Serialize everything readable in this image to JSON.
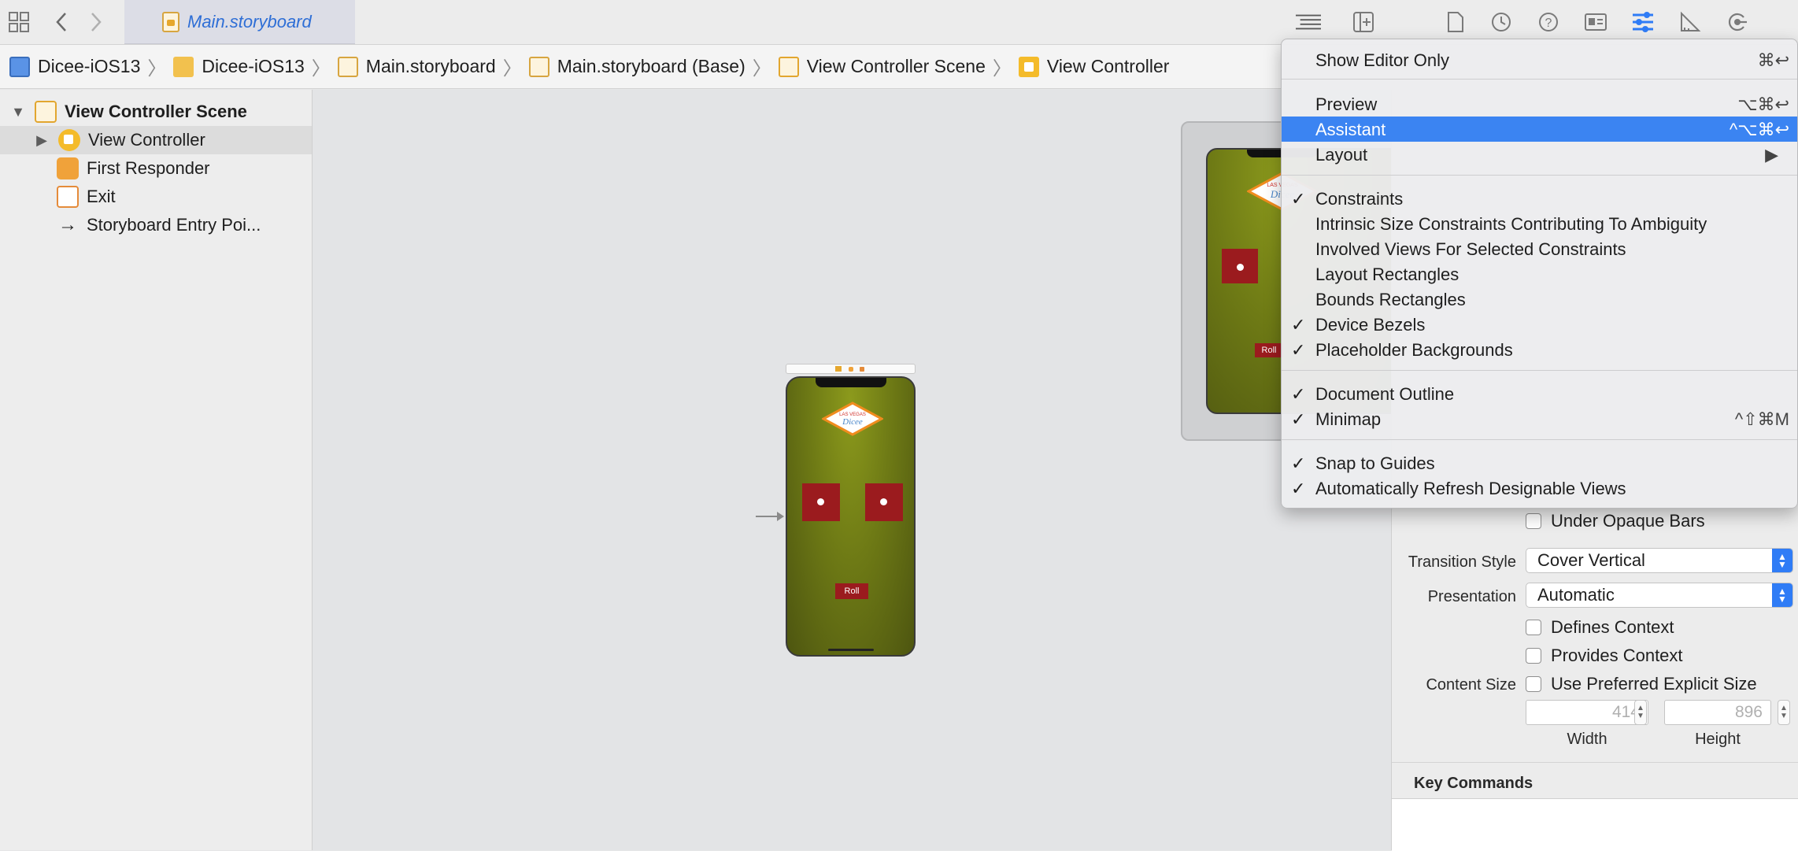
{
  "toolbar": {
    "tab_title": "Main.storyboard",
    "icons": [
      "grid-icon",
      "back-arrow-icon",
      "forward-arrow-icon",
      "editor-options-icon",
      "add-editor-icon",
      "file-inspector-icon",
      "history-inspector-icon",
      "help-inspector-icon",
      "identity-inspector-icon",
      "attributes-inspector-icon",
      "size-inspector-icon",
      "connections-inspector-icon"
    ]
  },
  "breadcrumb": [
    {
      "label": "Dicee-iOS13",
      "icon": "project-icon"
    },
    {
      "label": "Dicee-iOS13",
      "icon": "folder-icon"
    },
    {
      "label": "Main.storyboard",
      "icon": "storyboard-file-icon"
    },
    {
      "label": "Main.storyboard (Base)",
      "icon": "storyboard-file-icon"
    },
    {
      "label": "View Controller Scene",
      "icon": "scene-icon"
    },
    {
      "label": "View Controller",
      "icon": "view-controller-icon"
    }
  ],
  "navigator": {
    "scene": "View Controller Scene",
    "items": [
      "View Controller",
      "First Responder",
      "Exit",
      "Storyboard Entry Poi..."
    ]
  },
  "canvas": {
    "roll_label": "Roll",
    "logo_top": "LAS VEGAS",
    "logo_main": "Dicee"
  },
  "menu": {
    "items": [
      {
        "label": "Show Editor Only",
        "shortcut": "⌘↩",
        "checked": false
      },
      {
        "label": "Preview",
        "shortcut": "⌥⌘↩",
        "checked": false
      },
      {
        "label": "Assistant",
        "shortcut": "^⌥⌘↩",
        "checked": false,
        "highlighted": true
      },
      {
        "label": "Layout",
        "shortcut": "▶",
        "checked": false
      },
      {
        "label": "Constraints",
        "shortcut": "",
        "checked": true
      },
      {
        "label": "Intrinsic Size Constraints Contributing To Ambiguity",
        "shortcut": "",
        "checked": false
      },
      {
        "label": "Involved Views For Selected Constraints",
        "shortcut": "",
        "checked": false
      },
      {
        "label": "Layout Rectangles",
        "shortcut": "",
        "checked": false
      },
      {
        "label": "Bounds Rectangles",
        "shortcut": "",
        "checked": false
      },
      {
        "label": "Device Bezels",
        "shortcut": "",
        "checked": true
      },
      {
        "label": "Placeholder Backgrounds",
        "shortcut": "",
        "checked": true
      },
      {
        "label": "Document Outline",
        "shortcut": "",
        "checked": true
      },
      {
        "label": "Minimap",
        "shortcut": "^⇧⌘M",
        "checked": true
      },
      {
        "label": "Snap to Guides",
        "shortcut": "",
        "checked": true
      },
      {
        "label": "Automatically Refresh Designable Views",
        "shortcut": "",
        "checked": true
      }
    ],
    "check_glyph": "✓"
  },
  "inspector": {
    "under_opaque_bars": "Under Opaque Bars",
    "transition_style_label": "Transition Style",
    "transition_style_value": "Cover Vertical",
    "presentation_label": "Presentation",
    "presentation_value": "Automatic",
    "defines_context": "Defines Context",
    "provides_context": "Provides Context",
    "content_size_label": "Content Size",
    "use_preferred": "Use Preferred Explicit Size",
    "width_placeholder": "414",
    "height_placeholder": "896",
    "width_label": "Width",
    "height_label": "Height",
    "key_commands": "Key Commands"
  },
  "colors": {
    "accent": "#3b84f2",
    "tab_text": "#2e6ed6",
    "dice_red": "#9b1b1e",
    "phone_green": "#6e7a15"
  }
}
